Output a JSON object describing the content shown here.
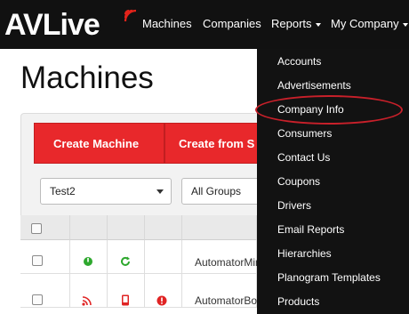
{
  "brand": {
    "logo_text_av": "AV",
    "logo_text_live": "Live"
  },
  "nav": {
    "machines": "Machines",
    "companies": "Companies",
    "reports": "Reports",
    "my_company": "My Company"
  },
  "page": {
    "title": "Machines"
  },
  "actions": {
    "create_machine": "Create Machine",
    "create_from": "Create from S"
  },
  "filters": {
    "company_select": "Test2",
    "group_select": "All Groups"
  },
  "table": {
    "rows": [
      {
        "name": "AutomatorMin"
      },
      {
        "name": "AutomatorBo"
      }
    ]
  },
  "my_company_menu": {
    "items": [
      "Accounts",
      "Advertisements",
      "Company Info",
      "Consumers",
      "Contact Us",
      "Coupons",
      "Drivers",
      "Email Reports",
      "Hierarchies",
      "Planogram Templates",
      "Products"
    ],
    "highlighted": "Company Info"
  },
  "colors": {
    "brand_red": "#e2231a",
    "navbar": "#111111",
    "button_red": "#e8282b",
    "status_green": "#2ea82e",
    "status_red": "#e02424",
    "annotation_red": "#c8202a"
  },
  "icons": {
    "row1": [
      "power-icon",
      "refresh-icon"
    ],
    "row2": [
      "signal-icon",
      "mobile-icon",
      "alert-icon"
    ]
  }
}
